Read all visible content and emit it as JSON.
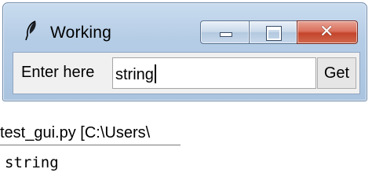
{
  "window": {
    "title": "Working",
    "icon": "feather-icon",
    "controls": {
      "minimize": "minimize-icon",
      "maximize": "maximize-icon",
      "close": "close-icon",
      "close_color": "#c4442b"
    }
  },
  "form": {
    "label": "Enter here",
    "entry_value": "string",
    "button_label": "Get"
  },
  "console": {
    "tab_title": "test_gui.py [C:\\Users\\",
    "output": "string"
  }
}
